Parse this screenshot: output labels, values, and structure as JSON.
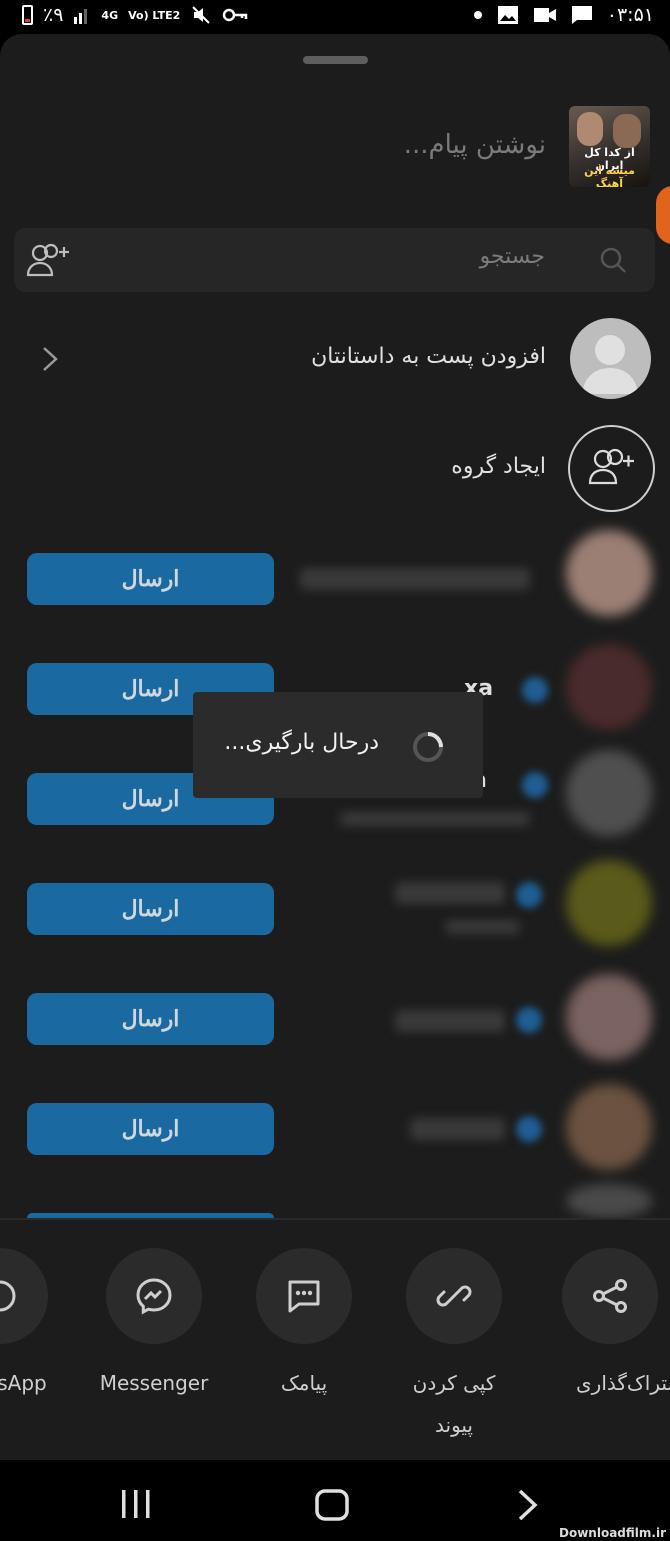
{
  "status_bar": {
    "battery": "٪۹",
    "network": "4G",
    "lte": "Vo) LTE2",
    "time": "۰۳:۵۱"
  },
  "thumbnail": {
    "line1": "از کدا کل ایران",
    "line2": "میشه این آهنگ"
  },
  "message_input": {
    "placeholder": "نوشتن پیام..."
  },
  "search": {
    "placeholder": "جستجو"
  },
  "actions": {
    "add_to_story": "افزودن پست به داستانتان",
    "create_group": "ایجاد گروه"
  },
  "contacts": [
    {
      "send_label": "ارسال"
    },
    {
      "send_label": "ارسال",
      "name_fragment": "xa"
    },
    {
      "send_label": "ارسال",
      "name_fragment": "a"
    },
    {
      "send_label": "ارسال"
    },
    {
      "send_label": "ارسال"
    },
    {
      "send_label": "ارسال"
    }
  ],
  "loading": {
    "text": "درحال بارگیری..."
  },
  "share_options": [
    {
      "label": "sApp",
      "icon": "whatsapp-icon"
    },
    {
      "label": "Messenger",
      "icon": "messenger-icon"
    },
    {
      "label": "پیامک",
      "icon": "sms-icon"
    },
    {
      "label": "کپی کردن پیوند",
      "icon": "link-icon"
    },
    {
      "label": "اشتراک‌گذاری",
      "icon": "share-icon"
    }
  ],
  "watermark": "Downloadfilm.ir",
  "colors": {
    "send_button": "#1a6aa1",
    "sheet_bg": "#1c1c1c",
    "accent_orange": "#e0641c"
  }
}
